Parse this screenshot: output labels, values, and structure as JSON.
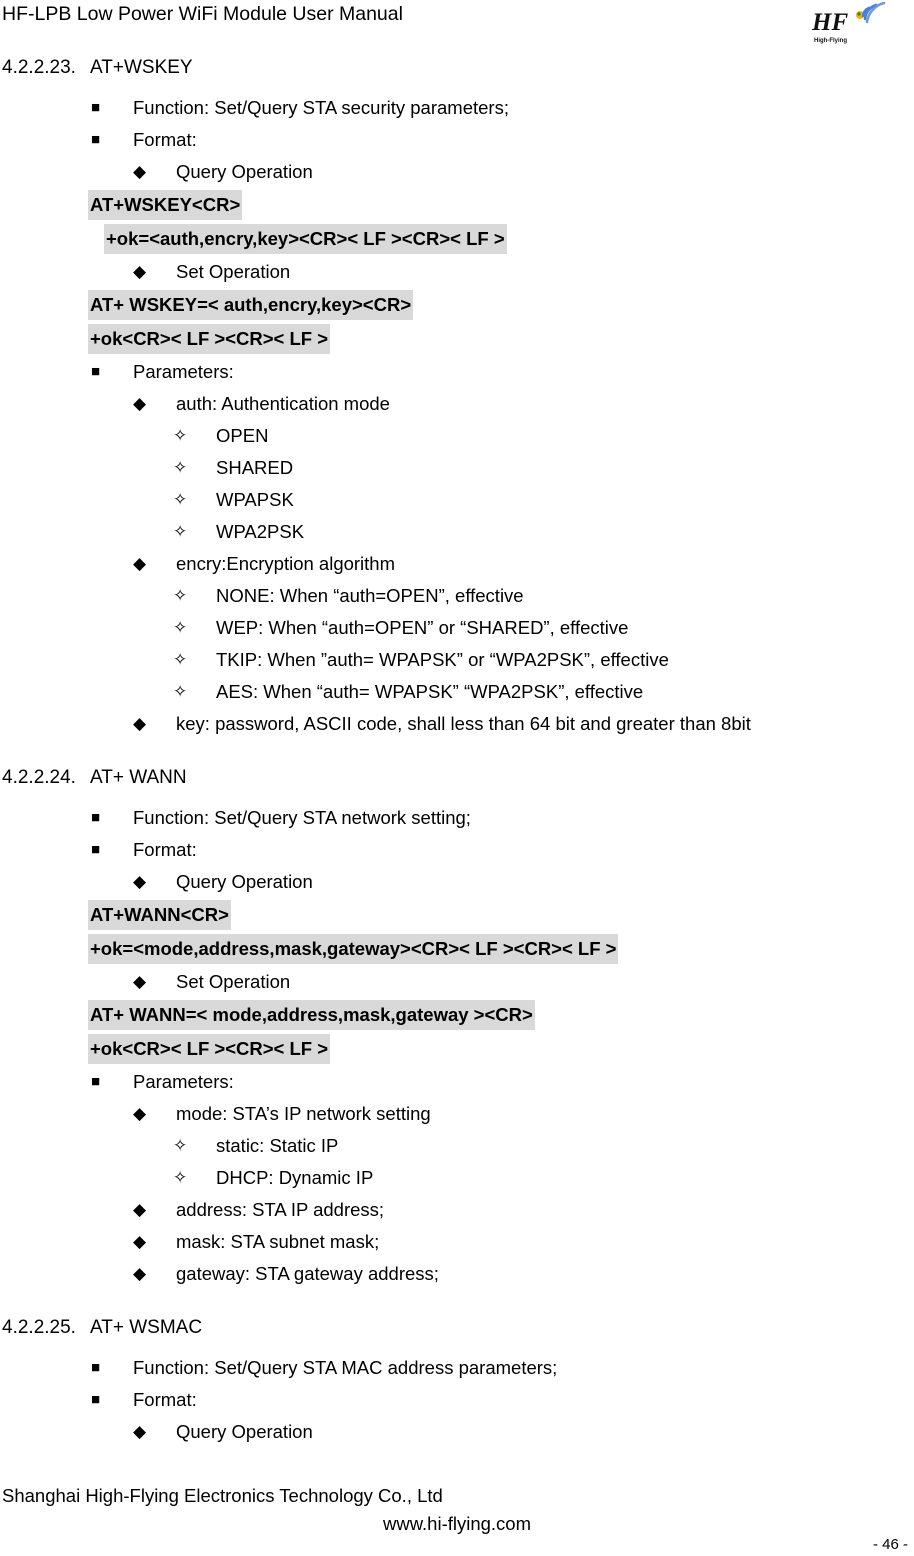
{
  "header": {
    "title": "HF-LPB Low Power WiFi Module User Manual",
    "logo_mark": "HF",
    "logo_tagline": "High-Flying",
    "logo_icon": "wifi-signal-icon"
  },
  "sections": [
    {
      "number": "4.2.2.23.",
      "title": "AT+WSKEY",
      "lines": [
        {
          "level": 1,
          "bullet": "square",
          "text": "Function: Set/Query STA security parameters;"
        },
        {
          "level": 1,
          "bullet": "square",
          "text": "Format:"
        },
        {
          "level": 2,
          "bullet": "diamond",
          "text": "Query Operation"
        },
        {
          "level": "code",
          "indent": 0,
          "text": "AT+WSKEY<CR>"
        },
        {
          "level": "code",
          "indent": 1,
          "text": "+ok=<auth,encry,key><CR>< LF ><CR>< LF >"
        },
        {
          "level": 2,
          "bullet": "diamond",
          "text": "Set Operation"
        },
        {
          "level": "code",
          "indent": 0,
          "text": "AT+ WSKEY=< auth,encry,key><CR>"
        },
        {
          "level": "code",
          "indent": 0,
          "text": "+ok<CR>< LF ><CR>< LF >"
        },
        {
          "level": 1,
          "bullet": "square",
          "text": "Parameters:"
        },
        {
          "level": 2,
          "bullet": "diamond",
          "text": "auth: Authentication mode"
        },
        {
          "level": 3,
          "bullet": "star",
          "text": "OPEN"
        },
        {
          "level": 3,
          "bullet": "star",
          "text": "SHARED"
        },
        {
          "level": 3,
          "bullet": "star",
          "text": "WPAPSK"
        },
        {
          "level": 3,
          "bullet": "star",
          "text": "WPA2PSK"
        },
        {
          "level": 2,
          "bullet": "diamond",
          "text": "encry:Encryption algorithm"
        },
        {
          "level": 3,
          "bullet": "star",
          "text": "NONE: When “auth=OPEN”, effective"
        },
        {
          "level": 3,
          "bullet": "star",
          "text": "WEP:   When “auth=OPEN” or “SHARED”, effective"
        },
        {
          "level": 3,
          "bullet": "star",
          "text": "TKIP:   When ”auth= WPAPSK” or “WPA2PSK”, effective"
        },
        {
          "level": 3,
          "bullet": "star",
          "text": "AES:    When “auth= WPAPSK” “WPA2PSK”, effective"
        },
        {
          "level": 2,
          "bullet": "diamond",
          "text": "key: password, ASCII code, shall less than 64 bit and greater than 8bit"
        }
      ]
    },
    {
      "number": "4.2.2.24.",
      "title": "AT+ WANN",
      "lines": [
        {
          "level": 1,
          "bullet": "square",
          "text": "Function: Set/Query STA network setting;"
        },
        {
          "level": 1,
          "bullet": "square",
          "text": "Format:"
        },
        {
          "level": 2,
          "bullet": "diamond",
          "text": "Query Operation"
        },
        {
          "level": "code",
          "indent": 0,
          "text": "AT+WANN<CR>"
        },
        {
          "level": "code",
          "indent": 0,
          "text": "+ok=<mode,address,mask,gateway><CR>< LF ><CR>< LF >"
        },
        {
          "level": 2,
          "bullet": "diamond",
          "text": "Set Operation"
        },
        {
          "level": "code",
          "indent": 0,
          "text": "AT+ WANN=< mode,address,mask,gateway ><CR>"
        },
        {
          "level": "code",
          "indent": 0,
          "text": "+ok<CR>< LF ><CR>< LF >"
        },
        {
          "level": 1,
          "bullet": "square",
          "text": "Parameters:"
        },
        {
          "level": 2,
          "bullet": "diamond",
          "text": "mode: STA’s IP network setting"
        },
        {
          "level": 3,
          "bullet": "star",
          "text": "static:   Static IP"
        },
        {
          "level": 3,
          "bullet": "star",
          "text": "DHCP:  Dynamic IP"
        },
        {
          "level": 2,
          "bullet": "diamond",
          "text": "address: STA IP address;"
        },
        {
          "level": 2,
          "bullet": "diamond",
          "text": "mask: STA subnet mask;"
        },
        {
          "level": 2,
          "bullet": "diamond",
          "text": "gateway: STA gateway address;"
        }
      ]
    },
    {
      "number": "4.2.2.25.",
      "title": "AT+ WSMAC",
      "lines": [
        {
          "level": 1,
          "bullet": "square",
          "text": "Function: Set/Query STA MAC address parameters;"
        },
        {
          "level": 1,
          "bullet": "square",
          "text": "Format:"
        },
        {
          "level": 2,
          "bullet": "diamond",
          "text": "Query Operation"
        }
      ]
    }
  ],
  "footer": {
    "company": "Shanghai High-Flying Electronics Technology Co., Ltd",
    "url": "www.hi-flying.com",
    "page_number": "- 46 -"
  },
  "glyphs": {
    "square": "■",
    "diamond": "◆",
    "star": "✧"
  },
  "colors": {
    "highlight": "#d9d9d9",
    "text": "#000000",
    "logo_blue": "#3b6fd4",
    "logo_yellow": "#f0b400"
  }
}
